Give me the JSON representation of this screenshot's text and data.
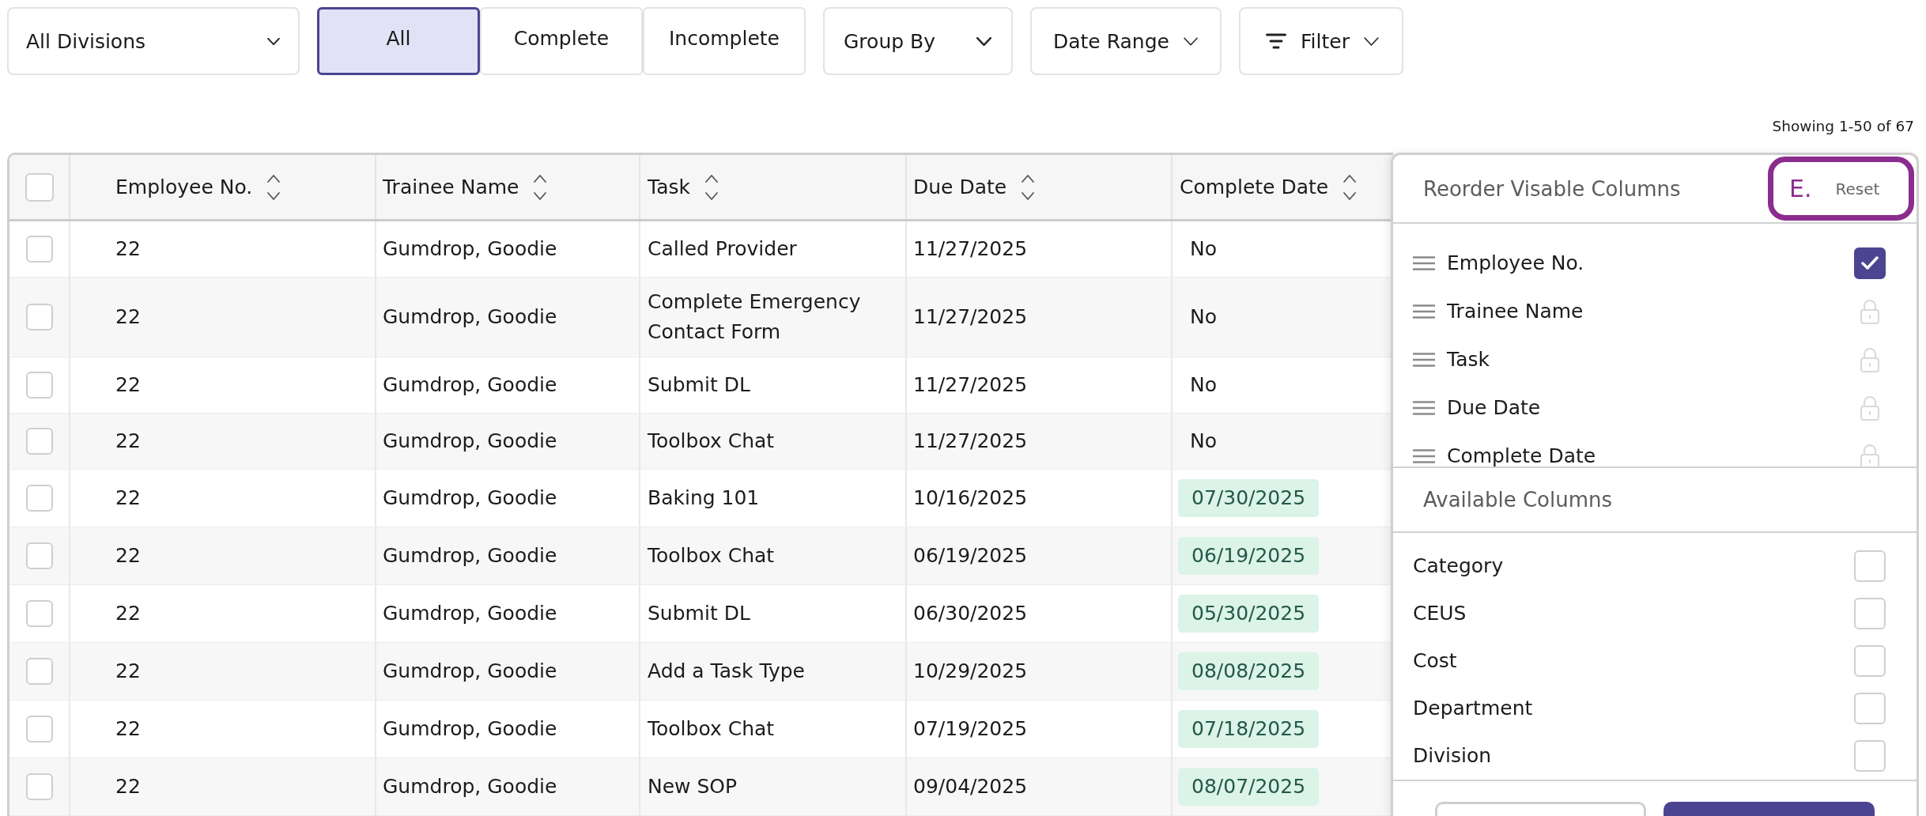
{
  "toolbar": {
    "division_select": {
      "value": "All Divisions"
    },
    "status_tabs": [
      {
        "label": "All",
        "selected": true
      },
      {
        "label": "Complete",
        "selected": false
      },
      {
        "label": "Incomplete",
        "selected": false
      }
    ],
    "group_by": {
      "label": "Group By"
    },
    "date_range": {
      "label": "Date Range"
    },
    "filter": {
      "label": "Filter"
    }
  },
  "result_count": "Showing 1-50 of 67",
  "table": {
    "select_all": {
      "checked": false
    },
    "columns": [
      {
        "label": "Employee No.",
        "sortable": true
      },
      {
        "label": "Trainee Name",
        "sortable": true
      },
      {
        "label": "Task",
        "sortable": true
      },
      {
        "label": "Due Date",
        "sortable": true
      },
      {
        "label": "Complete Date",
        "sortable": true
      }
    ],
    "rows": [
      {
        "checked": false,
        "employee_no": "22",
        "trainee_name": "Gumdrop, Goodie",
        "task": "Called Provider",
        "due_date": "11/27/2025",
        "complete_date": "No",
        "completed": false
      },
      {
        "checked": false,
        "employee_no": "22",
        "trainee_name": "Gumdrop, Goodie",
        "task": "Complete Emergency Contact Form",
        "due_date": "11/27/2025",
        "complete_date": "No",
        "completed": false
      },
      {
        "checked": false,
        "employee_no": "22",
        "trainee_name": "Gumdrop, Goodie",
        "task": "Submit DL",
        "due_date": "11/27/2025",
        "complete_date": "No",
        "completed": false
      },
      {
        "checked": false,
        "employee_no": "22",
        "trainee_name": "Gumdrop, Goodie",
        "task": "Toolbox Chat",
        "due_date": "11/27/2025",
        "complete_date": "No",
        "completed": false
      },
      {
        "checked": false,
        "employee_no": "22",
        "trainee_name": "Gumdrop, Goodie",
        "task": "Baking 101",
        "due_date": "10/16/2025",
        "complete_date": "07/30/2025",
        "completed": true
      },
      {
        "checked": false,
        "employee_no": "22",
        "trainee_name": "Gumdrop, Goodie",
        "task": "Toolbox Chat",
        "due_date": "06/19/2025",
        "complete_date": "06/19/2025",
        "completed": true
      },
      {
        "checked": false,
        "employee_no": "22",
        "trainee_name": "Gumdrop, Goodie",
        "task": "Submit DL",
        "due_date": "06/30/2025",
        "complete_date": "05/30/2025",
        "completed": true
      },
      {
        "checked": false,
        "employee_no": "22",
        "trainee_name": "Gumdrop, Goodie",
        "task": "Add a Task Type",
        "due_date": "10/29/2025",
        "complete_date": "08/08/2025",
        "completed": true
      },
      {
        "checked": false,
        "employee_no": "22",
        "trainee_name": "Gumdrop, Goodie",
        "task": "Toolbox Chat",
        "due_date": "07/19/2025",
        "complete_date": "07/18/2025",
        "completed": true
      },
      {
        "checked": false,
        "employee_no": "22",
        "trainee_name": "Gumdrop, Goodie",
        "task": "New SOP",
        "due_date": "09/04/2025",
        "complete_date": "08/07/2025",
        "completed": true
      }
    ]
  },
  "column_panel": {
    "title": "Reorder Visable Columns",
    "annotation": {
      "label": "E."
    },
    "reset": "Reset",
    "visible_columns": [
      {
        "label": "Employee No.",
        "kind": "checkbox",
        "checked": true
      },
      {
        "label": "Trainee Name",
        "kind": "locked"
      },
      {
        "label": "Task",
        "kind": "locked"
      },
      {
        "label": "Due Date",
        "kind": "locked"
      },
      {
        "label": "Complete Date",
        "kind": "locked"
      }
    ],
    "available_title": "Available Columns",
    "available_columns": [
      {
        "label": "Category",
        "checked": false
      },
      {
        "label": "CEUS",
        "checked": false
      },
      {
        "label": "Cost",
        "checked": false
      },
      {
        "label": "Department",
        "checked": false
      },
      {
        "label": "Division",
        "checked": false
      }
    ],
    "footer_buttons": [
      {
        "kind": "secondary"
      },
      {
        "kind": "primary"
      }
    ]
  }
}
